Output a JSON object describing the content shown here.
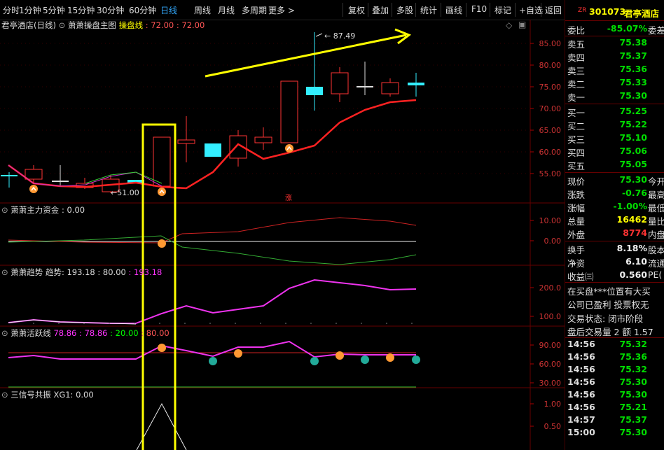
{
  "toolbar": {
    "left": [
      "分时",
      "1分钟",
      "5分钟",
      "15分钟",
      "30分钟",
      "60分钟",
      "日线",
      "周线",
      "月线",
      "多周期",
      "更多 >"
    ],
    "active_index": 6,
    "right": [
      "复权",
      "叠加",
      "多股",
      "统计",
      "画线",
      "F10",
      "标记",
      "+自选",
      "返回"
    ]
  },
  "main_panel": {
    "title": "君亭酒店(日线)",
    "indicator_name": "萧萧操盘主图",
    "line_label": "操盘线",
    "line_value": ": 72.00",
    "line_value2": ": 72.00",
    "high_label": "87.49",
    "low_label": "51.00",
    "marker": "涨",
    "axis": [
      "85.00",
      "80.00",
      "75.00",
      "70.00",
      "65.00",
      "60.00",
      "55.00"
    ]
  },
  "panel2": {
    "title": "萧萧主力资金",
    "value": ": 0.00",
    "axis": [
      "10.00",
      "0.00"
    ]
  },
  "panel3": {
    "title": "萧萧趋势",
    "sub": "趋势: 193.18",
    "v2": ": 80.00",
    "v3": ": 193.18",
    "axis": [
      "200.0",
      "100.0"
    ]
  },
  "panel4": {
    "title": "萧萧活跃线",
    "v1": "78.86",
    "v2": ": 78.86",
    "v3": ": 20.00",
    "v4": ": 80.00",
    "axis": [
      "90.00",
      "60.00",
      "30.00"
    ]
  },
  "panel5": {
    "title": "三信号共振",
    "sub": "XG1: 0.00",
    "axis": [
      "1.00",
      "0.50"
    ]
  },
  "quote": {
    "zr": "ZR",
    "code": "301073",
    "name": "君亭酒店",
    "webi_label": "委比",
    "webi_value": "-85.07%",
    "webi_tail": "委差",
    "asks": [
      {
        "label": "卖五",
        "price": "75.38"
      },
      {
        "label": "卖四",
        "price": "75.37"
      },
      {
        "label": "卖三",
        "price": "75.36"
      },
      {
        "label": "卖二",
        "price": "75.33"
      },
      {
        "label": "卖一",
        "price": "75.30"
      }
    ],
    "bids": [
      {
        "label": "买一",
        "price": "75.25"
      },
      {
        "label": "买二",
        "price": "75.22"
      },
      {
        "label": "买三",
        "price": "75.10"
      },
      {
        "label": "买四",
        "price": "75.06"
      },
      {
        "label": "买五",
        "price": "75.05"
      }
    ],
    "stats": [
      {
        "label": "现价",
        "value": "75.30",
        "tail": "今开",
        "color": "green"
      },
      {
        "label": "涨跌",
        "value": "-0.76",
        "tail": "最高",
        "color": "green"
      },
      {
        "label": "涨幅",
        "value": "-1.00%",
        "tail": "最低",
        "color": "green"
      },
      {
        "label": "总量",
        "value": "16462",
        "tail": "量比",
        "color": "yellow"
      },
      {
        "label": "外盘",
        "value": "8774",
        "tail": "内盘",
        "color": "red"
      }
    ],
    "stats2": [
      {
        "label": "换手",
        "value": "8.18%",
        "tail": "股本"
      },
      {
        "label": "净资",
        "value": "6.10",
        "tail": "流通"
      },
      {
        "label": "收益㈢",
        "value": "0.560",
        "tail": "PE("
      }
    ],
    "info": [
      "在买盘***位置有大买",
      "公司已盈利 投票权无",
      "交易状态: 闭市阶段",
      "盘后交易量 2 额 1.57"
    ],
    "ticks": [
      {
        "time": "14:56",
        "price": "75.32"
      },
      {
        "time": "14:56",
        "price": "75.36"
      },
      {
        "time": "14:56",
        "price": "75.32"
      },
      {
        "time": "14:56",
        "price": "75.30"
      },
      {
        "time": "14:56",
        "price": "75.30"
      },
      {
        "time": "14:56",
        "price": "75.21"
      },
      {
        "time": "14:57",
        "price": "75.37"
      },
      {
        "time": "15:00",
        "price": "75.30"
      }
    ]
  }
}
